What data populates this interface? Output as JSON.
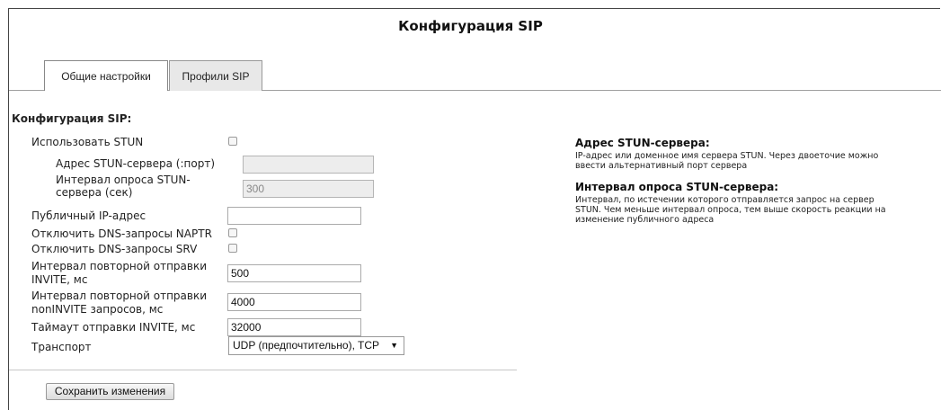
{
  "page": {
    "title": "Конфигурация SIP"
  },
  "tabs": [
    {
      "label": "Общие настройки",
      "active": true
    },
    {
      "label": "Профили SIP",
      "active": false
    }
  ],
  "section": {
    "title": "Конфигурация SIP:"
  },
  "form": {
    "use_stun": {
      "label": "Использовать STUN",
      "checked": false
    },
    "stun_server": {
      "label": "Адрес STUN-сервера (:порт)",
      "value": "",
      "disabled": true
    },
    "stun_interval": {
      "label_line1": "Интервал опроса STUN-",
      "label_line2": "сервера (сек)",
      "value": "300",
      "disabled": true
    },
    "public_ip": {
      "label": "Публичный IP-адрес",
      "value": ""
    },
    "disable_naptr": {
      "label": "Отключить DNS-запросы NAPTR",
      "checked": false
    },
    "disable_srv": {
      "label": "Отключить DNS-запросы SRV",
      "checked": false
    },
    "invite_retry": {
      "label_line1": "Интервал повторной отправки",
      "label_line2": "INVITE, мс",
      "value": "500"
    },
    "noninvite_retry": {
      "label_line1": "Интервал повторной отправки",
      "label_line2": "nonINVITE запросов, мс",
      "value": "4000"
    },
    "invite_timeout": {
      "label": "Таймаут отправки INVITE, мс",
      "value": "32000"
    },
    "transport": {
      "label": "Транспорт",
      "selected": "UDP (предпочтительно), TCP"
    }
  },
  "save_button": {
    "label": "Сохранить изменения"
  },
  "help": [
    {
      "title": "Адрес STUN-сервера:",
      "line1": "IP-адрес или доменное имя сервера STUN. Через двоеточие можно",
      "line2": "ввести альтернативный порт сервера",
      "line3": ""
    },
    {
      "title": "Интервал опроса STUN-сервера:",
      "line1": "Интервал, по истечении которого отправляется запрос на сервер",
      "line2": "STUN. Чем меньше интервал опроса, тем выше скорость реакции на",
      "line3": "изменение публичного адреса"
    }
  ]
}
